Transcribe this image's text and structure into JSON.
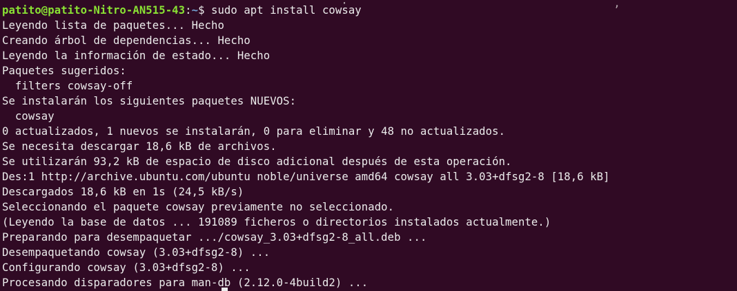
{
  "terminal": {
    "top_partial_text": "                                                   ·                                        ,",
    "prompt": {
      "user_host": "patito@patito-Nitro-AN515-43",
      "colon": ":",
      "path": "~",
      "sign": "$ ",
      "command": "sudo apt install cowsay"
    },
    "output": [
      "Leyendo lista de paquetes... Hecho",
      "Creando árbol de dependencias... Hecho",
      "Leyendo la información de estado... Hecho",
      "Paquetes sugeridos:",
      "  filters cowsay-off",
      "Se instalarán los siguientes paquetes NUEVOS:",
      "  cowsay",
      "0 actualizados, 1 nuevos se instalarán, 0 para eliminar y 48 no actualizados.",
      "Se necesita descargar 18,6 kB de archivos.",
      "Se utilizarán 93,2 kB de espacio de disco adicional después de esta operación.",
      "Des:1 http://archive.ubuntu.com/ubuntu noble/universe amd64 cowsay all 3.03+dfsg2-8 [18,6 kB]",
      "Descargados 18,6 kB en 1s (24,5 kB/s)",
      "Seleccionando el paquete cowsay previamente no seleccionado.",
      "(Leyendo la base de datos ... 191089 ficheros o directorios instalados actualmente.)",
      "Preparando para desempaquetar .../cowsay_3.03+dfsg2-8_all.deb ...",
      "Desempaquetando cowsay (3.03+dfsg2-8) ...",
      "Configurando cowsay (3.03+dfsg2-8) ...",
      "Procesando disparadores para man-db (2.12.0-4build2) ..."
    ]
  },
  "colors": {
    "background": "#300a24",
    "text": "#ececec",
    "prompt_user": "#8ae234",
    "prompt_path": "#729fcf"
  }
}
